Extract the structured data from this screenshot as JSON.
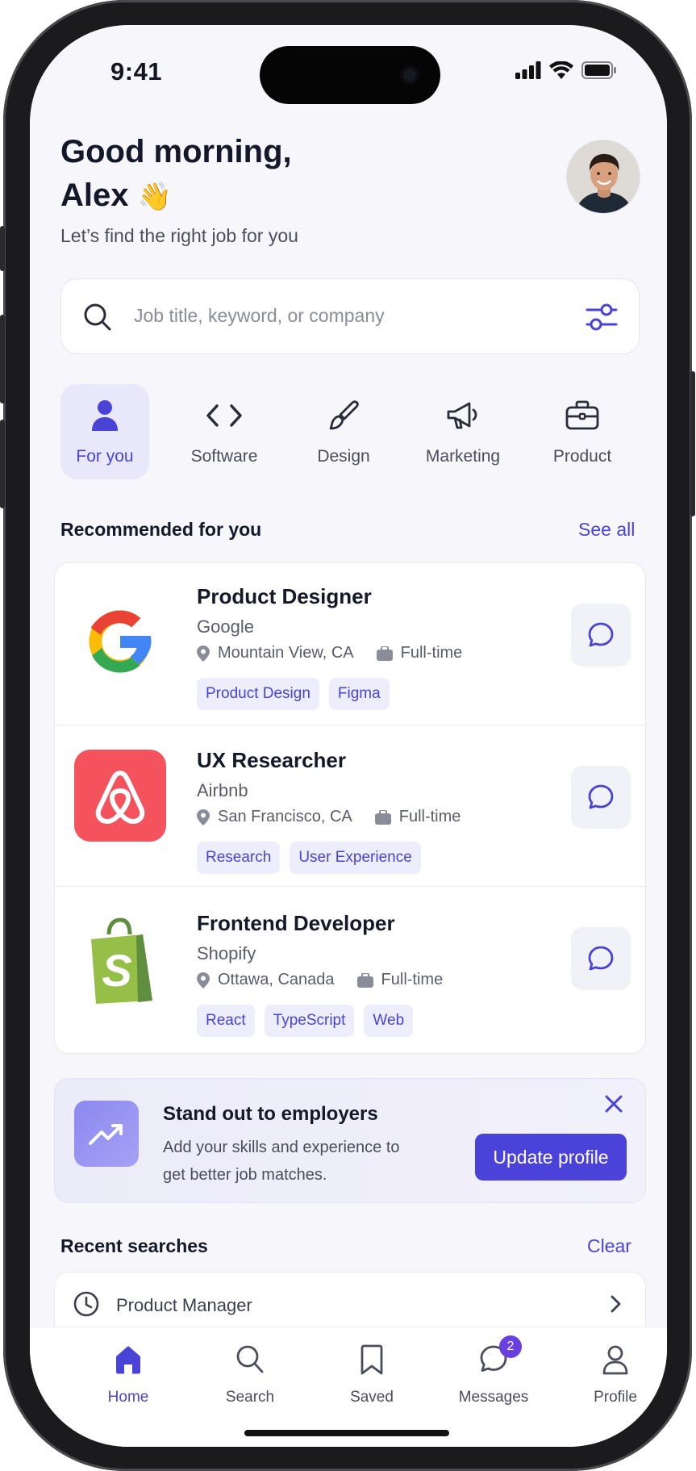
{
  "status": {
    "time": "9:41"
  },
  "header": {
    "greeting_line1": "Good morning,",
    "greeting_name": "Alex",
    "greeting_emoji": "👋",
    "subtitle": "Let’s find the right job for you"
  },
  "search": {
    "placeholder": "Job title, keyword, or company"
  },
  "categories": [
    {
      "label": "For you",
      "icon": "person-icon",
      "active": true
    },
    {
      "label": "Software",
      "icon": "code-icon",
      "active": false
    },
    {
      "label": "Design",
      "icon": "brush-icon",
      "active": false
    },
    {
      "label": "Marketing",
      "icon": "megaphone-icon",
      "active": false
    },
    {
      "label": "Product",
      "icon": "briefcase-icon",
      "active": false
    }
  ],
  "recommended": {
    "title": "Recommended for you",
    "link": "See all",
    "jobs": [
      {
        "title": "Product Designer",
        "company": "Google",
        "location": "Mountain View, CA",
        "type": "Full-time",
        "tags": [
          "Product Design",
          "Figma"
        ],
        "logo": "google-logo"
      },
      {
        "title": "UX Researcher",
        "company": "Airbnb",
        "location": "San Francisco, CA",
        "type": "Full-time",
        "tags": [
          "Research",
          "User Experience"
        ],
        "logo": "airbnb-logo"
      },
      {
        "title": "Frontend Developer",
        "company": "Shopify",
        "location": "Ottawa, Canada",
        "type": "Full-time",
        "tags": [
          "React",
          "TypeScript",
          "Web"
        ],
        "logo": "shopify-logo"
      }
    ]
  },
  "promo": {
    "title": "Stand out to employers",
    "description": "Add your skills and experience to get better job matches.",
    "button": "Update profile"
  },
  "recent": {
    "title": "Recent searches",
    "link": "Clear",
    "items": [
      "Product Manager"
    ]
  },
  "tabbar": [
    {
      "label": "Home",
      "icon": "home-icon",
      "active": true
    },
    {
      "label": "Search",
      "icon": "search-icon",
      "active": false
    },
    {
      "label": "Saved",
      "icon": "bookmark-icon",
      "active": false
    },
    {
      "label": "Messages",
      "icon": "message-icon",
      "active": false,
      "badge": "2"
    },
    {
      "label": "Profile",
      "icon": "profile-icon",
      "active": false
    }
  ],
  "colors": {
    "accent": "#4a44d6",
    "background": "#f7f7fb",
    "airbnb": "#f4525c",
    "shopify": "#95bf47"
  }
}
